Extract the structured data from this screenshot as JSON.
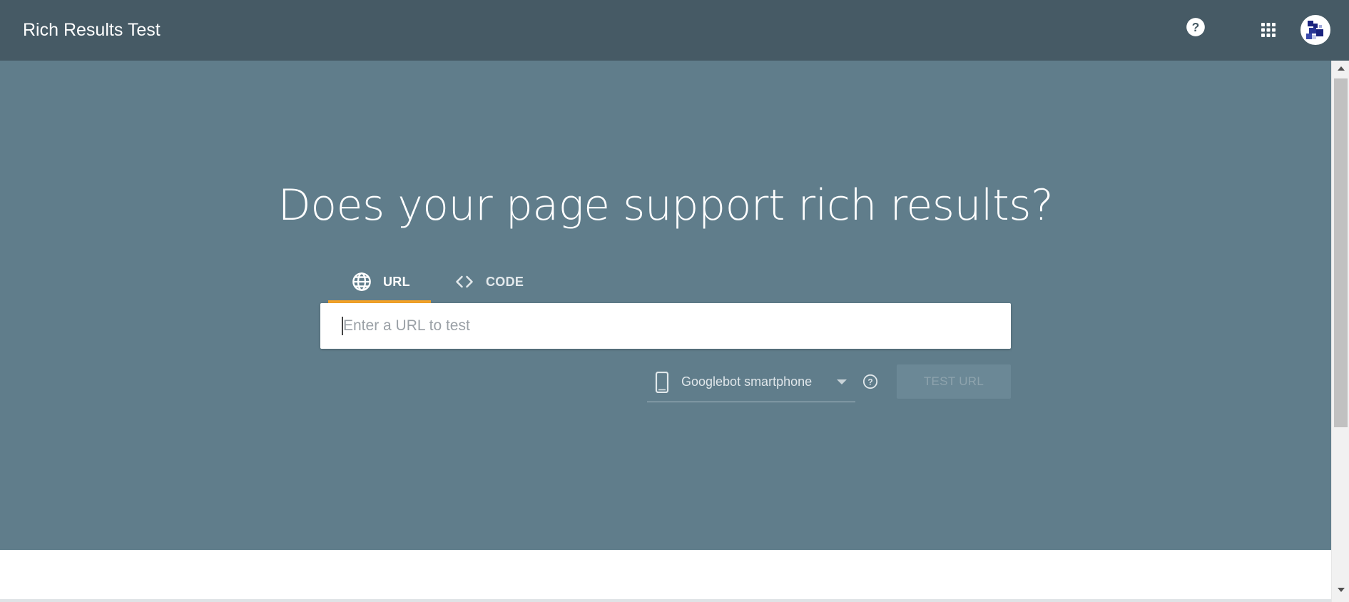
{
  "header": {
    "title": "Rich Results Test",
    "help_icon": "help-icon",
    "apps_icon": "apps-grid-icon",
    "avatar_icon": "account-avatar"
  },
  "hero": {
    "headline": "Does your page support rich results?",
    "tabs": [
      {
        "label": "URL",
        "icon": "globe-icon",
        "selected": true
      },
      {
        "label": "CODE",
        "icon": "code-brackets-icon",
        "selected": false
      }
    ],
    "url_input": {
      "value": "",
      "placeholder": "Enter a URL to test"
    },
    "user_agent": {
      "selected": "Googlebot smartphone",
      "icon": "smartphone-icon"
    },
    "test_button_label": "TEST URL",
    "test_button_enabled": false
  },
  "colors": {
    "header_bg": "#465a65",
    "hero_bg": "#607d8b",
    "tab_underline": "#f4a329",
    "button_bg": "#6b8896"
  }
}
